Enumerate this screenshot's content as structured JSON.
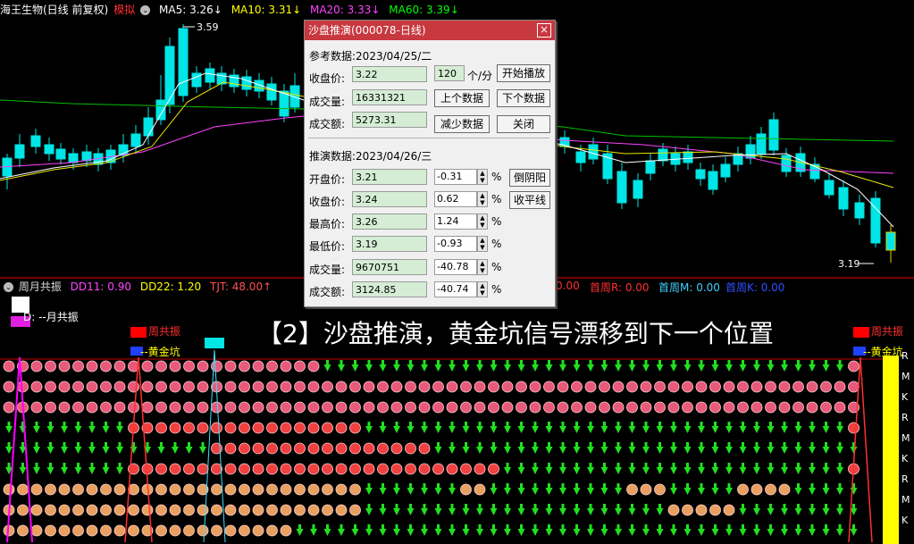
{
  "header": {
    "stock_name": "海王生物(日线 前复权)",
    "mode_tag": "模拟",
    "ma5": "MA5: 3.26↓",
    "ma10": "MA10: 3.31↓",
    "ma20": "MA20: 3.33↓",
    "ma60": "MA60: 3.39↓",
    "colors": {
      "ma5": "#ffffff",
      "ma10": "#ffff00",
      "ma20": "#ff44ff",
      "ma60": "#00ff00",
      "mode": "#ff3030"
    }
  },
  "main_chart": {
    "high_label": "3.59",
    "low_label": "3.19"
  },
  "indicator_bar": {
    "name": "周月共振",
    "dd11": "DD11: 0.90",
    "dd22": "DD22: 1.20",
    "tjt": "TJT: 48.00↑",
    "r_fragment": "0.00",
    "shouzhou_r": "首周R: 0.00",
    "shouzhou_m": "首周M: 0.00",
    "shouzhou_k": "首周K: 0.00"
  },
  "lower_panel": {
    "yuegongzhen": "D: --月共振",
    "zhougongzhen_1": "周共振",
    "huangjinkeng_1": "--黄金坑",
    "zhougongzhen_2": "周共振",
    "huangjinkeng_2": "--黄金坑",
    "right_labels": [
      "R",
      "M",
      "K",
      "R",
      "M",
      "K",
      "R",
      "M",
      "K"
    ],
    "overlay_title": "【2】沙盘推演，黄金坑信号漂移到下一个位置"
  },
  "dialog": {
    "title": "沙盘推演(000078-日线)",
    "close_label": "×",
    "ref_label": "参考数据:2023/04/25/二",
    "ref_close_label": "收盘价:",
    "ref_close_value": "3.22",
    "ref_volume_label": "成交量:",
    "ref_volume_value": "16331321",
    "ref_amount_label": "成交额:",
    "ref_amount_value": "5273.31",
    "speed_value": "120",
    "speed_unit": "个/分",
    "btn_play": "开始播放",
    "btn_prev": "上个数据",
    "btn_next": "下个数据",
    "btn_reduce": "减少数据",
    "btn_close": "关闭",
    "sim_label": "推演数据:2023/04/26/三",
    "rows": [
      {
        "label": "开盘价:",
        "value": "3.21",
        "pct": "-0.31"
      },
      {
        "label": "收盘价:",
        "value": "3.24",
        "pct": "0.62"
      },
      {
        "label": "最高价:",
        "value": "3.26",
        "pct": "1.24"
      },
      {
        "label": "最低价:",
        "value": "3.19",
        "pct": "-0.93"
      },
      {
        "label": "成交量:",
        "value": "9670751",
        "pct": "-40.78"
      },
      {
        "label": "成交额:",
        "value": "3124.85",
        "pct": "-40.74"
      }
    ],
    "pct_unit": "%",
    "btn_yinyang": "倒阴阳",
    "btn_flat": "收平线"
  }
}
